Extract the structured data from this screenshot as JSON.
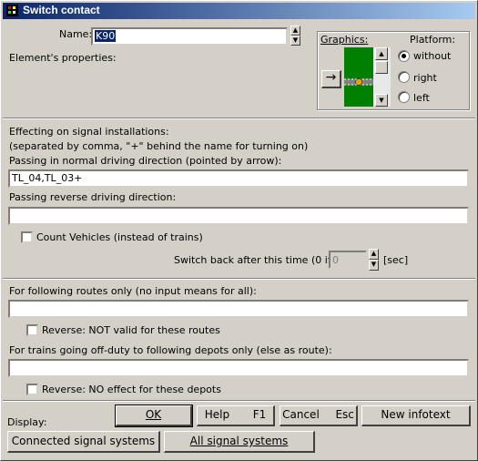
{
  "window": {
    "title": "Switch contact",
    "controls": [
      "_",
      "□",
      "×"
    ]
  },
  "name_section": {
    "label": "Name:",
    "value": "K90",
    "properties_label": "Element's properties:"
  },
  "graphics": {
    "label": "Graphics:",
    "arrow": "→"
  },
  "platform": {
    "label": "Platform:",
    "options": [
      {
        "label": "without",
        "selected": true
      },
      {
        "label": "right",
        "selected": false
      },
      {
        "label": "left",
        "selected": false
      }
    ]
  },
  "signals": {
    "heading1": "Effecting on signal installations:",
    "heading2": "(separated by comma, \"+\" behind the name for turning on)",
    "normal_label": "Passing in normal driving direction (pointed by arrow):",
    "normal_value": "TL_04,TL_03+",
    "reverse_label": "Passing reverse driving direction:",
    "reverse_value": "",
    "count_vehicles_label": "Count Vehicles (instead of trains)",
    "count_vehicles_checked": false,
    "switch_back_label": "Switch back after this time (0 if not):",
    "switch_back_value": "0",
    "switch_back_unit": "[sec]"
  },
  "routes": {
    "label": "For following routes only (no input means for all):",
    "value": "",
    "reverse_label": "Reverse: NOT valid for these routes",
    "reverse_checked": false
  },
  "depots": {
    "label": "For trains going off-duty to following depots only (else as route):",
    "value": "",
    "reverse_label": "Reverse: NO effect for these depots",
    "reverse_checked": false
  },
  "footer": {
    "display_label": "Display:",
    "ok": "OK",
    "help": "Help",
    "help_key": "F1",
    "cancel": "Cancel",
    "cancel_key": "Esc",
    "new_infotext": "New infotext",
    "connected": "Connected signal systems",
    "all_signals": "All signal systems"
  },
  "colors": {
    "titlebar_start": "#0a246a",
    "titlebar_end": "#a6caf0",
    "face": "#d4d0c8",
    "preview_green": "#007f00"
  }
}
